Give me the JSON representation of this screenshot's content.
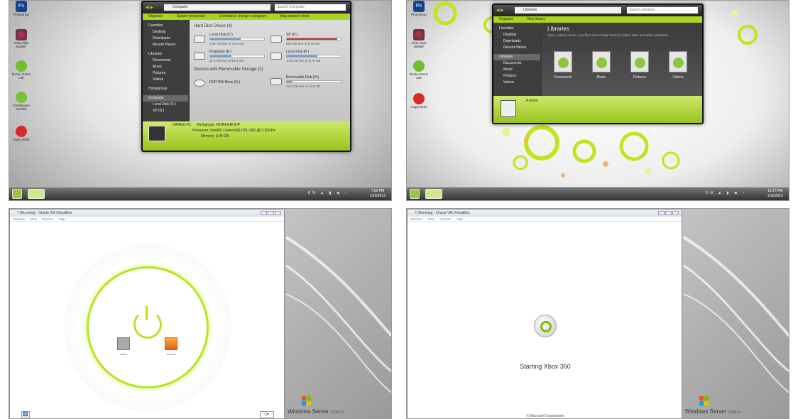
{
  "desktop_icons": [
    "Photoshop",
    "Vista Style Builder",
    "Rocko Game Lab",
    "Crackposter Xmedia",
    "Angry Birds"
  ],
  "desktop_icons_2": [
    "Photoshop",
    "Vista Style Builder",
    "Rocko Game Lab",
    "Angry Birds"
  ],
  "s1": {
    "path": "Computer",
    "search": "Search Computer",
    "commands": [
      "Organize",
      "System properties",
      "Uninstall or change a program",
      "Map network drive"
    ],
    "nav": [
      "Favorites",
      "Desktop",
      "Downloads",
      "Recent Places",
      "Libraries",
      "Documents",
      "Music",
      "Pictures",
      "Videos",
      "Homegroup",
      "Computer",
      "Local Disk (C:)",
      "XP (D:)"
    ],
    "section1": "Hard Disk Drives (4)",
    "section2": "Devices with Removable Storage (2)",
    "drives": [
      {
        "name": "Local Disk (C:)",
        "free": "8.62 GB free of 19.5 GB",
        "used": 0.56
      },
      {
        "name": "XP (D:)",
        "free": "699 MB free of 9.76 GB",
        "used": 0.93
      },
      {
        "name": "Programs (E:)",
        "free": "11.8 GB free of 19.5 GB",
        "used": 0.4
      },
      {
        "name": "Local Disk (F:)",
        "free": "4.31 GB free of 9.76 GB",
        "used": 0.56
      },
      {
        "name": "DVD RW Drive (G:)",
        "free": "",
        "used": 0
      },
      {
        "name": "Removable Disk (H:)",
        "free": "13.2 GB free of 14.9 GB",
        "used": 0.11
      }
    ],
    "details": {
      "pc": "HAMED-PC",
      "line1": "Workgroup:  WORKGROUP",
      "line2": "Processor:  Intel(R) Celeron(R) CPU        900  @ 2.20GHz",
      "line3": "Memory:  3.00 GB"
    },
    "lang": "EN",
    "time": "7:52 PM",
    "date": "1/16/2012"
  },
  "s2": {
    "path": "Libraries",
    "search": "Search Libraries",
    "commands": [
      "Organize",
      "New library"
    ],
    "nav": [
      "Favorites",
      "Desktop",
      "Downloads",
      "Recent Places",
      "Libraries",
      "Documents",
      "Music",
      "Pictures",
      "Videos"
    ],
    "heading": "Libraries",
    "subheading": "Open a library to see your files and arrange them by folder, date, and other properties.",
    "libraries": [
      "Documents",
      "Music",
      "Pictures",
      "Videos"
    ],
    "count": "4 items",
    "lang": "EN",
    "time": "11:57 PM",
    "date": "1/16/2012"
  },
  "vm": {
    "title": "7 [Running] - Oracle VM VirtualBox",
    "menu": [
      "Machine",
      "View",
      "Devices",
      "Help"
    ],
    "users": [
      "admin",
      "hamed"
    ],
    "status": "Starting Xbox 360",
    "copyright": "© Microsoft Corporation",
    "brand": "Windows Server",
    "version": "2008 R2"
  },
  "colors": {
    "accent": "#9bc53d",
    "lime": "#a9d41f",
    "ring": "#b5e61d"
  }
}
